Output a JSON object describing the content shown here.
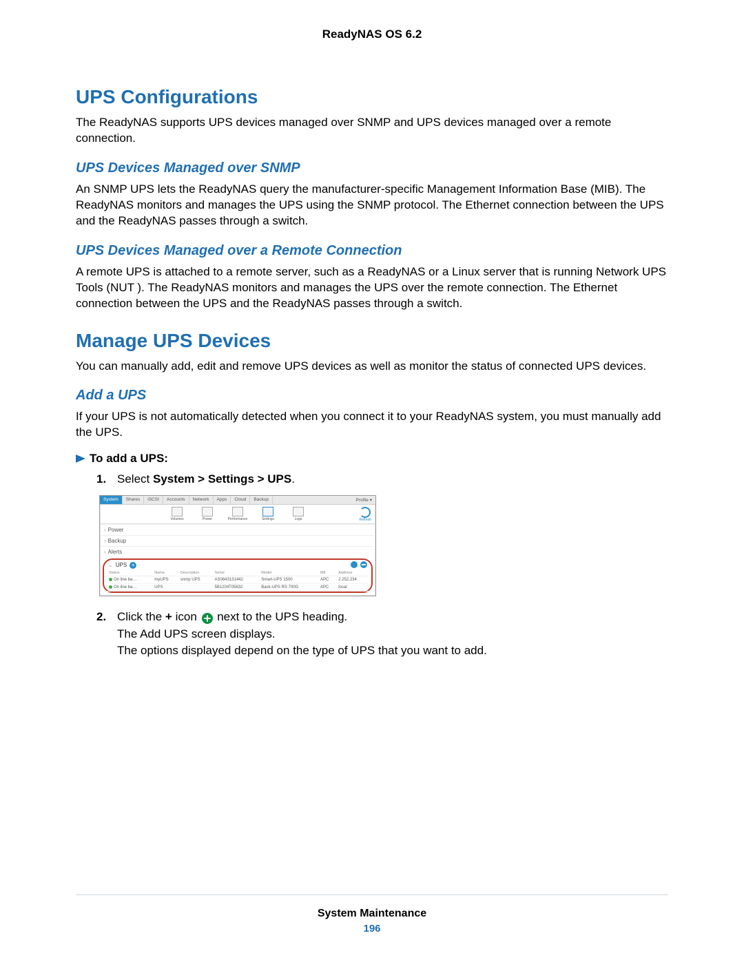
{
  "header": {
    "title": "ReadyNAS OS 6.2"
  },
  "sections": {
    "ups_config": {
      "heading": "UPS Configurations",
      "intro": "The ReadyNAS supports UPS devices managed over SNMP and UPS devices managed over a remote connection.",
      "snmp": {
        "heading": "UPS Devices Managed over SNMP",
        "body": "An SNMP UPS lets the ReadyNAS query the manufacturer-specific Management Information Base (MIB). The ReadyNAS monitors and manages the UPS using the SNMP protocol. The Ethernet connection between the UPS and the ReadyNAS passes through a switch."
      },
      "remote": {
        "heading": "UPS Devices Managed over a Remote Connection",
        "body": "A remote UPS is attached to a remote server, such as a ReadyNAS or a Linux server that is running Network UPS Tools (NUT ). The ReadyNAS monitors and manages the UPS over the remote connection. The Ethernet connection between the UPS and the ReadyNAS passes through a switch."
      }
    },
    "manage": {
      "heading": "Manage UPS Devices",
      "intro": "You can manually add, edit and remove UPS devices as well as monitor the status of connected UPS devices.",
      "add": {
        "heading": "Add a UPS",
        "intro": "If your UPS is not automatically detected when you connect it to your ReadyNAS system, you must manually add the UPS.",
        "procedure_title": "To add a UPS:",
        "steps": {
          "1": {
            "num": "1.",
            "prefix": "Select ",
            "bold": "System > Settings > UPS",
            "suffix": "."
          },
          "2": {
            "num": "2.",
            "line1a": "Click the ",
            "plus": "+",
            "line1b": " icon ",
            "line1c": " next to the UPS heading.",
            "line2": "The Add UPS screen displays.",
            "line3": "The options displayed depend on the type of UPS that you want to add."
          }
        }
      }
    }
  },
  "screenshot": {
    "tabs": [
      "System",
      "Shares",
      "iSCSI",
      "Accounts",
      "Network",
      "Apps",
      "Cloud",
      "Backup"
    ],
    "active_tab": "System",
    "profile": "Profile ▾",
    "toolbar": [
      "Volumes",
      "Power",
      "Performance",
      "Settings",
      "Logs"
    ],
    "toolbar_names": [
      "volumes-icon",
      "power-icon",
      "performance-icon",
      "settings-icon",
      "logs-icon"
    ],
    "refresh": "Refresh",
    "rows": [
      "Power",
      "Backup",
      "Alerts"
    ],
    "ups": {
      "label": "UPS",
      "columns": [
        "Status",
        "Name",
        "Description",
        "Serial",
        "Model",
        "Mfr",
        "Address"
      ],
      "data": [
        {
          "status": "On line ba…",
          "name": "myUPS",
          "desc": "snmp UPS",
          "serial": "AS0643131442",
          "model": "Smart-UPS 1500",
          "mfr": "APC",
          "addr": "2.252.234"
        },
        {
          "status": "On line ba…",
          "name": "UPS",
          "desc": "",
          "serial": "5B1204T05832",
          "model": "Back-UPS RS 700G",
          "mfr": "APC",
          "addr": "local"
        }
      ]
    }
  },
  "footer": {
    "title": "System Maintenance",
    "page": "196"
  }
}
